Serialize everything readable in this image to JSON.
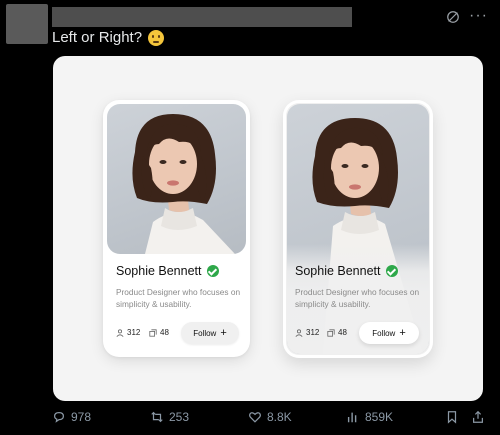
{
  "tweet": {
    "text": "Left or Right?",
    "emoji": "thinking-face-emoji"
  },
  "header": {
    "grok_icon": "grok-icon",
    "more_icon": "more-icon",
    "more_glyph": "···"
  },
  "cards": {
    "left": {
      "name": "Sophie Bennett",
      "description": "Product Designer who focuses on simplicity & usability.",
      "followers": "312",
      "posts": "48",
      "follow_label": "Follow",
      "plus": "+"
    },
    "right": {
      "name": "Sophie Bennett",
      "description": "Product Designer who focuses on simplicity & usability.",
      "followers": "312",
      "posts": "48",
      "follow_label": "Follow",
      "plus": "+"
    }
  },
  "actions": {
    "replies": "978",
    "reposts": "253",
    "likes": "8.8K",
    "views": "859K"
  },
  "colors": {
    "background": "#000000",
    "media_bg": "#f4f4f4",
    "verified": "#2ea84a",
    "action_text": "#8b98a5"
  }
}
